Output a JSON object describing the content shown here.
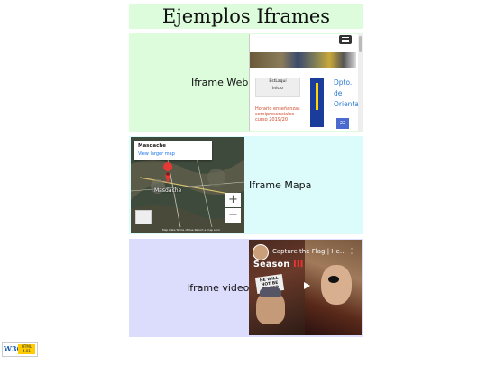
{
  "page": {
    "title": "Ejemplos Iframes"
  },
  "rows": {
    "web": {
      "label": "Iframe Web"
    },
    "map": {
      "label": "Iframe Mapa"
    },
    "video": {
      "label": "Iframe video"
    }
  },
  "web_iframe": {
    "box_line1": "EstLaquí",
    "box_line2": "Inicio",
    "news_text": "Horario enseñanzas semipresenciales curso 2019/20",
    "dept_text": "Dpto. de Orienta",
    "square_text": "22"
  },
  "map_iframe": {
    "place": "Masdache",
    "link": "View larger map",
    "town": "Masdache",
    "zoom_in": "+",
    "zoom_out": "−",
    "footer": "Map Data  Terms of Use  Report a map error",
    "colors": {
      "pin": "#e53935",
      "link": "#1a73e8"
    }
  },
  "video_iframe": {
    "title": "Capture the Flag | He…",
    "season_word": "Season",
    "season_num": "III",
    "sign_text": "HE WILL NOT BE DENIED",
    "menu_icon": "more-vert-icon"
  },
  "badge": {
    "w3c": "W3C",
    "html_label": "HTML 4.01"
  }
}
